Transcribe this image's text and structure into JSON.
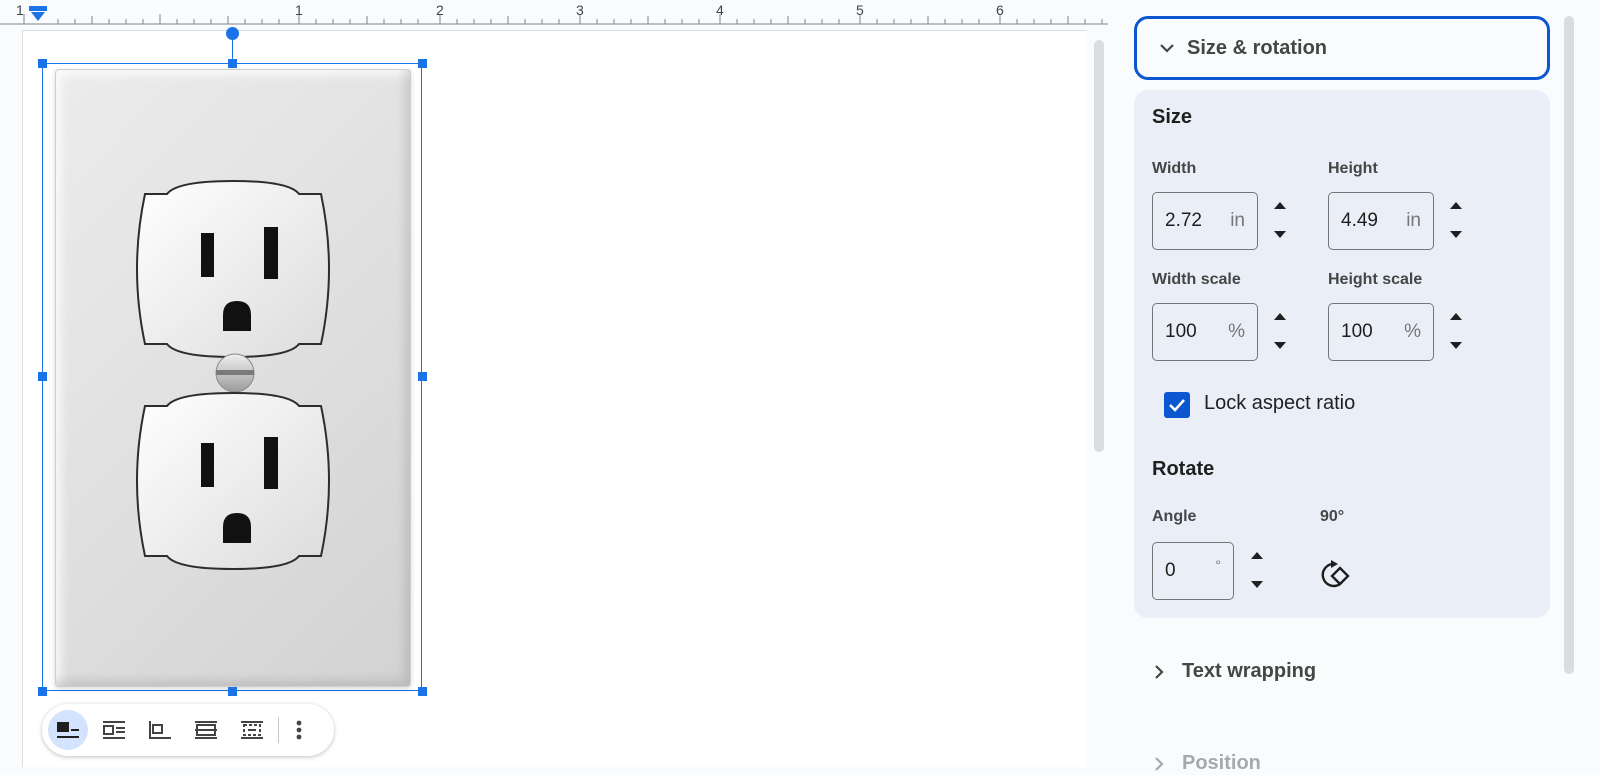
{
  "ruler": {
    "marks": [
      "1",
      "1",
      "2",
      "3",
      "4",
      "5",
      "6"
    ]
  },
  "toolbar": {
    "wrap_buttons": [
      "inline-icon",
      "wrap-text-icon",
      "break-text-icon",
      "behind-text-icon",
      "in-front-of-text-icon"
    ],
    "more_icon": "more-vert-icon"
  },
  "panel": {
    "section_title": "Size & rotation",
    "size_heading": "Size",
    "width_label": "Width",
    "width_value": "2.72",
    "width_unit": "in",
    "height_label": "Height",
    "height_value": "4.49",
    "height_unit": "in",
    "width_scale_label": "Width scale",
    "width_scale_value": "100",
    "width_scale_unit": "%",
    "height_scale_label": "Height scale",
    "height_scale_value": "100",
    "height_scale_unit": "%",
    "lock_label": "Lock aspect ratio",
    "lock_checked": true,
    "rotate_heading": "Rotate",
    "angle_label": "Angle",
    "angle_value": "0",
    "angle_unit": "°",
    "rotate_90_label": "90°",
    "text_wrapping_label": "Text wrapping",
    "position_label": "Position"
  },
  "colors": {
    "accent": "#0b57d0",
    "card": "#eaeff7",
    "selection": "#1a73e8"
  }
}
